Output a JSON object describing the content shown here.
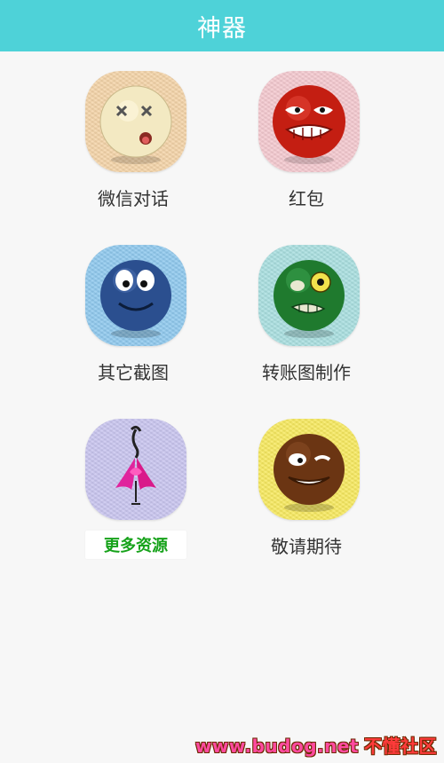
{
  "header": {
    "title": "神器"
  },
  "tiles": [
    {
      "label": "微信对话",
      "bg": "#f4d4a8",
      "icon": "dizzy-face-icon"
    },
    {
      "label": "红包",
      "bg": "#f4c9cf",
      "icon": "angry-face-icon"
    },
    {
      "label": "其它截图",
      "bg": "#8fc9ee",
      "icon": "blue-smiley-icon"
    },
    {
      "label": "转账图制作",
      "bg": "#a9dfe0",
      "icon": "green-zombie-icon"
    },
    {
      "label": "更多资源",
      "bg": "#c9c5ef",
      "icon": "ribbon-figure-icon"
    },
    {
      "label": "敬请期待",
      "bg": "#f7e95f",
      "icon": "brown-grin-icon"
    }
  ],
  "watermark": {
    "site": "www.budog.net",
    "name": "不懂社区"
  }
}
